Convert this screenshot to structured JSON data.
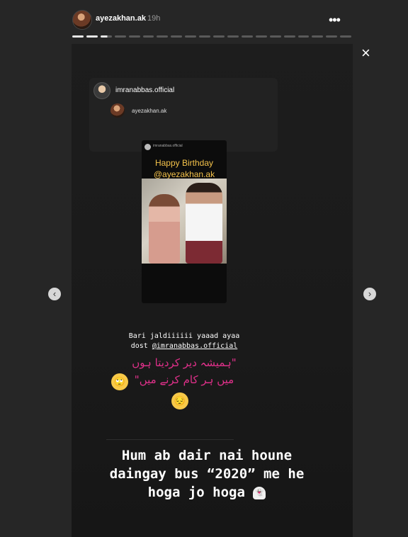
{
  "header": {
    "username": "ayezakhan.ak",
    "time": "19h",
    "more_icon": "more-icon"
  },
  "progress": {
    "segments": 20,
    "completed": 2,
    "current_fraction": 0.6
  },
  "story": {
    "repost": {
      "username": "imranabbas.official",
      "shared_username": "ayezakhan.ak",
      "inner_post": {
        "username": "imranabbas.official",
        "line1": "Happy Birthday",
        "line2": "@ayezakhan.ak"
      }
    },
    "caption1_line1": "Bari jaldiiiiii yaaad ayaa",
    "caption1_dost": "dost ",
    "caption1_mention": "@imranabbas.official",
    "urdu_line1": "\"ہمیشہ دیر کردیتا ہوں",
    "urdu_line2": "میں ہر کام کرنے میں\"",
    "eyeroll_emoji": "🙄",
    "pensive_emoji": "😔",
    "caption2_line1": "Hum ab dair nai houne",
    "caption2_line2": "daingay bus “2020” me he",
    "caption2_line3": "hoga jo hoga",
    "ghost_emoji": "👻"
  },
  "controls": {
    "close": "×",
    "prev": "‹",
    "next": "›"
  },
  "colors": {
    "background": "#262626",
    "caption_pink": "#e0308a",
    "birthday_gold": "#f4c24a"
  }
}
